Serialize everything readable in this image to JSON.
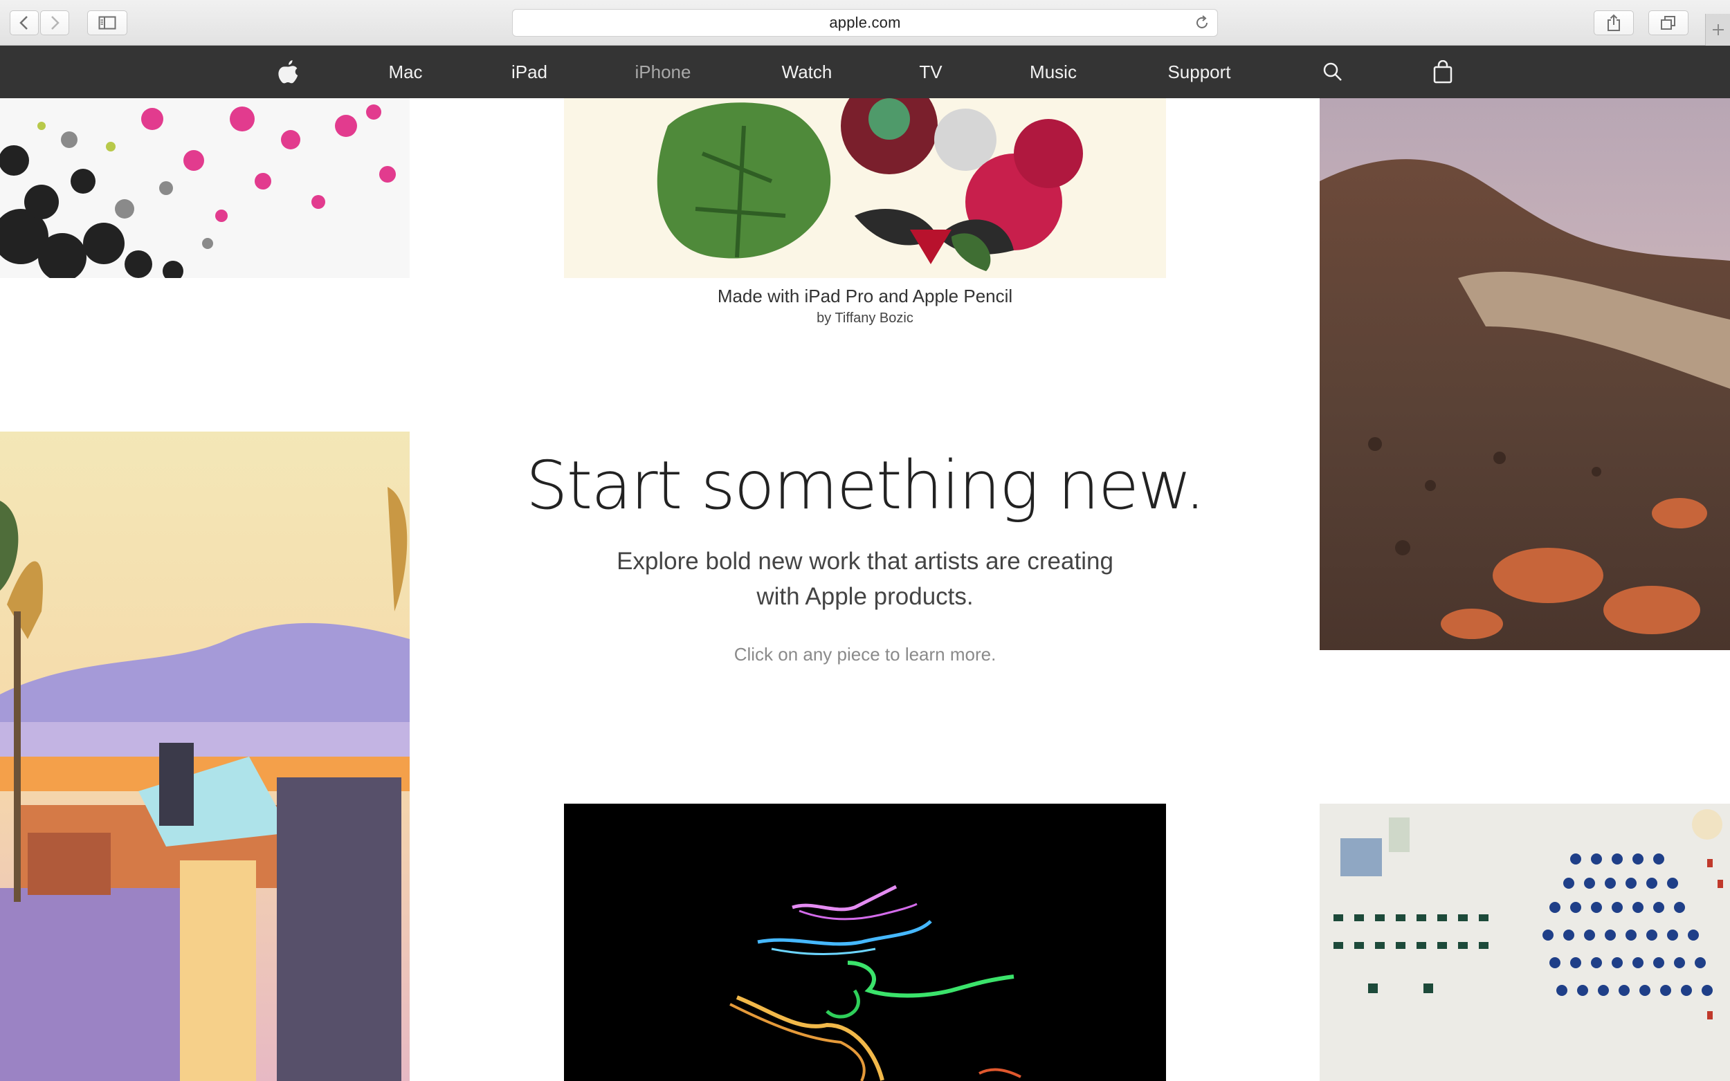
{
  "browser": {
    "url": "apple.com",
    "icons": {
      "back": "chevron-left-icon",
      "forward": "chevron-right-icon",
      "sidebar": "sidebar-icon",
      "reload": "reload-icon",
      "share": "share-icon",
      "tabs": "tabs-icon",
      "new_tab": "plus-icon"
    }
  },
  "globalnav": {
    "logo_icon": "apple-logo-icon",
    "items": [
      {
        "label": "Mac",
        "active": false
      },
      {
        "label": "iPad",
        "active": false
      },
      {
        "label": "iPhone",
        "active": true
      },
      {
        "label": "Watch",
        "active": false
      },
      {
        "label": "TV",
        "active": false
      },
      {
        "label": "Music",
        "active": false
      },
      {
        "label": "Support",
        "active": false
      }
    ],
    "search_icon": "search-icon",
    "bag_icon": "shopping-bag-icon",
    "colors": {
      "background": "#343434",
      "text": "#f2f2f2",
      "active_text": "#a9a9a9"
    }
  },
  "featured_caption": {
    "title": "Made with iPad Pro and Apple Pencil",
    "byline": "by Tiffany Bozic"
  },
  "hero": {
    "headline": "Start something new.",
    "subline": "Explore bold new work that artists are creating with Apple products.",
    "hint": "Click on any piece to learn more."
  }
}
